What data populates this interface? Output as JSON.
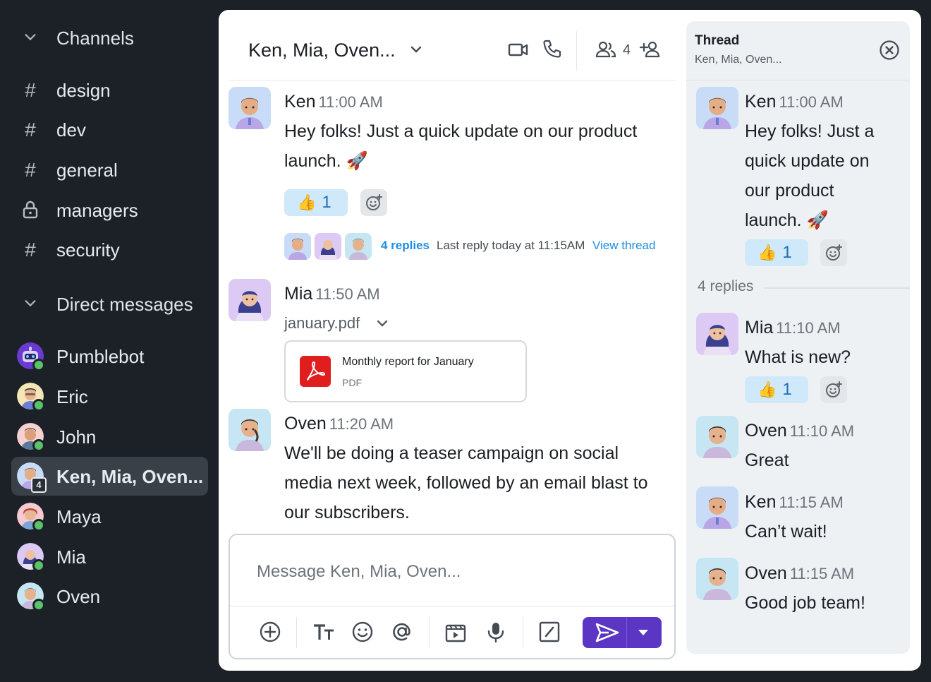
{
  "sidebar": {
    "channels_header": "Channels",
    "channels": [
      {
        "symbol": "#",
        "label": "design"
      },
      {
        "symbol": "#",
        "label": "dev"
      },
      {
        "symbol": "#",
        "label": "general"
      },
      {
        "symbol": "lock",
        "label": "managers"
      },
      {
        "symbol": "#",
        "label": "security"
      }
    ],
    "dm_header": "Direct messages",
    "dms": [
      {
        "label": "Pumblebot",
        "avatar": "bot",
        "active": false
      },
      {
        "label": "Eric",
        "avatar": "eric",
        "active": false
      },
      {
        "label": "John",
        "avatar": "john",
        "active": false
      },
      {
        "label": "Ken, Mia, Oven...",
        "avatar": "ken",
        "active": true,
        "badge": "4"
      },
      {
        "label": "Maya",
        "avatar": "maya",
        "active": false
      },
      {
        "label": "Mia",
        "avatar": "mia",
        "active": false
      },
      {
        "label": "Oven",
        "avatar": "oven",
        "active": false
      }
    ]
  },
  "chat": {
    "title": "Ken, Mia, Oven...",
    "member_count": "4",
    "messages": [
      {
        "name": "Ken",
        "time": "11:00 AM",
        "line1": "Hey folks! Just a quick update on our product",
        "line2": "launch. 🚀"
      },
      {
        "name": "Mia",
        "time": "11:50 AM"
      },
      {
        "name": "Oven",
        "time": "11:20 AM",
        "line1": "We'll be doing a teaser campaign on social",
        "line2": "media next week, followed by an email blast to",
        "line3": "our subscribers."
      }
    ],
    "reaction": {
      "emoji": "👍",
      "count": "1"
    },
    "replies": {
      "link": "4 replies",
      "meta": "Last reply today at 11:15AM",
      "view": "View thread"
    },
    "file": {
      "name": "january.pdf",
      "title": "Monthly report for January",
      "type": "PDF"
    },
    "composer_placeholder": "Message Ken, Mia, Oven..."
  },
  "thread": {
    "title": "Thread",
    "subtitle": "Ken, Mia, Oven...",
    "root": {
      "name": "Ken",
      "time": "11:00 AM",
      "lines": [
        "Hey folks! Just a",
        "quick update on",
        "our product",
        "launch. 🚀"
      ]
    },
    "reply_count": "4 replies",
    "replies": [
      {
        "name": "Mia",
        "time": "11:10 AM",
        "text": "What is new?"
      },
      {
        "name": "Oven",
        "time": "11:10 AM",
        "text": "Great"
      },
      {
        "name": "Ken",
        "time": "11:15 AM",
        "text": "Can’t wait!"
      },
      {
        "name": "Oven",
        "time": "11:15 AM",
        "text": "Good job team!"
      }
    ]
  },
  "colors": {
    "sidebar_bg": "#1c2127",
    "accent": "#5b35c4",
    "link": "#1e8ee6",
    "presence": "#59c36a",
    "reaction_bg": "#cfe9fb"
  }
}
